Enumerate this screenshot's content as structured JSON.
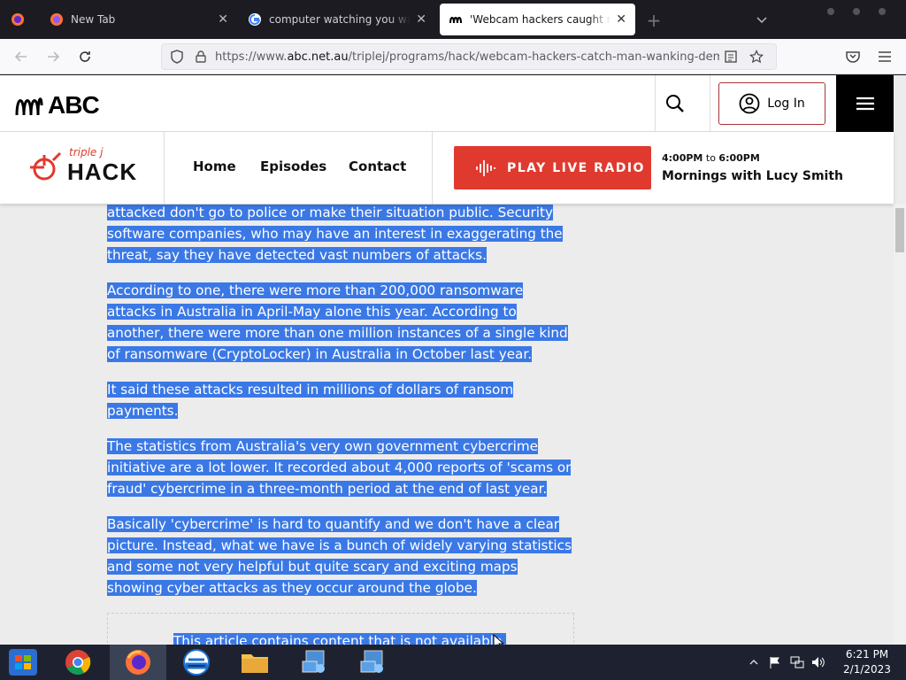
{
  "tabs": [
    {
      "title": "New Tab"
    },
    {
      "title": "computer watching you wank - Google Search"
    },
    {
      "title": "'Webcam hackers caught me wanking'"
    }
  ],
  "url": {
    "prefix": "https://www.",
    "domain": "abc.net.au",
    "path": "/triplej/programs/hack/webcam-hackers-catch-man-wanking-demand-ransom"
  },
  "abc": {
    "logo_text": "ABC",
    "login_label": "Log In"
  },
  "hack": {
    "brand_small": "triple j",
    "brand_big": "HACK",
    "nav": [
      "Home",
      "Episodes",
      "Contact"
    ],
    "play_label": "PLAY LIVE RADIO",
    "time_start": "4:00PM",
    "time_to": "to",
    "time_end": "6:00PM",
    "show_prefix": "Mornings with ",
    "show_host": "Lucy Smith"
  },
  "article": {
    "paragraphs": [
      "attacked don't go to police or make their situation public. Security software companies, who may have an interest in exaggerating the threat, say they have detected vast numbers of attacks.",
      "According to one, there were more than 200,000 ransomware attacks in Australia in April-May alone this year. According to another, there were more than one million instances of a single kind of ransomware (CryptoLocker) in Australia in October last year.",
      "It said these attacks resulted in millions of dollars of ransom payments.",
      "The statistics from Australia's very own government cybercrime initiative are a lot lower. It recorded about 4,000 reports of 'scams or fraud' cybercrime in a three-month period at the end of last year.",
      "Basically 'cybercrime' is hard to quantify and we don't have a clear picture. Instead, what we have is a bunch of widely varying statistics and some not very helpful but quite scary and exciting maps showing cyber attacks as they occur around the globe."
    ],
    "embed_notice": "This article contains content that is not available."
  },
  "taskbar": {
    "time": "6:21 PM",
    "date": "2/1/2023"
  },
  "colors": {
    "accent_red": "#e03a2f",
    "selection": "#3a78e6",
    "abc_black": "#000000"
  }
}
